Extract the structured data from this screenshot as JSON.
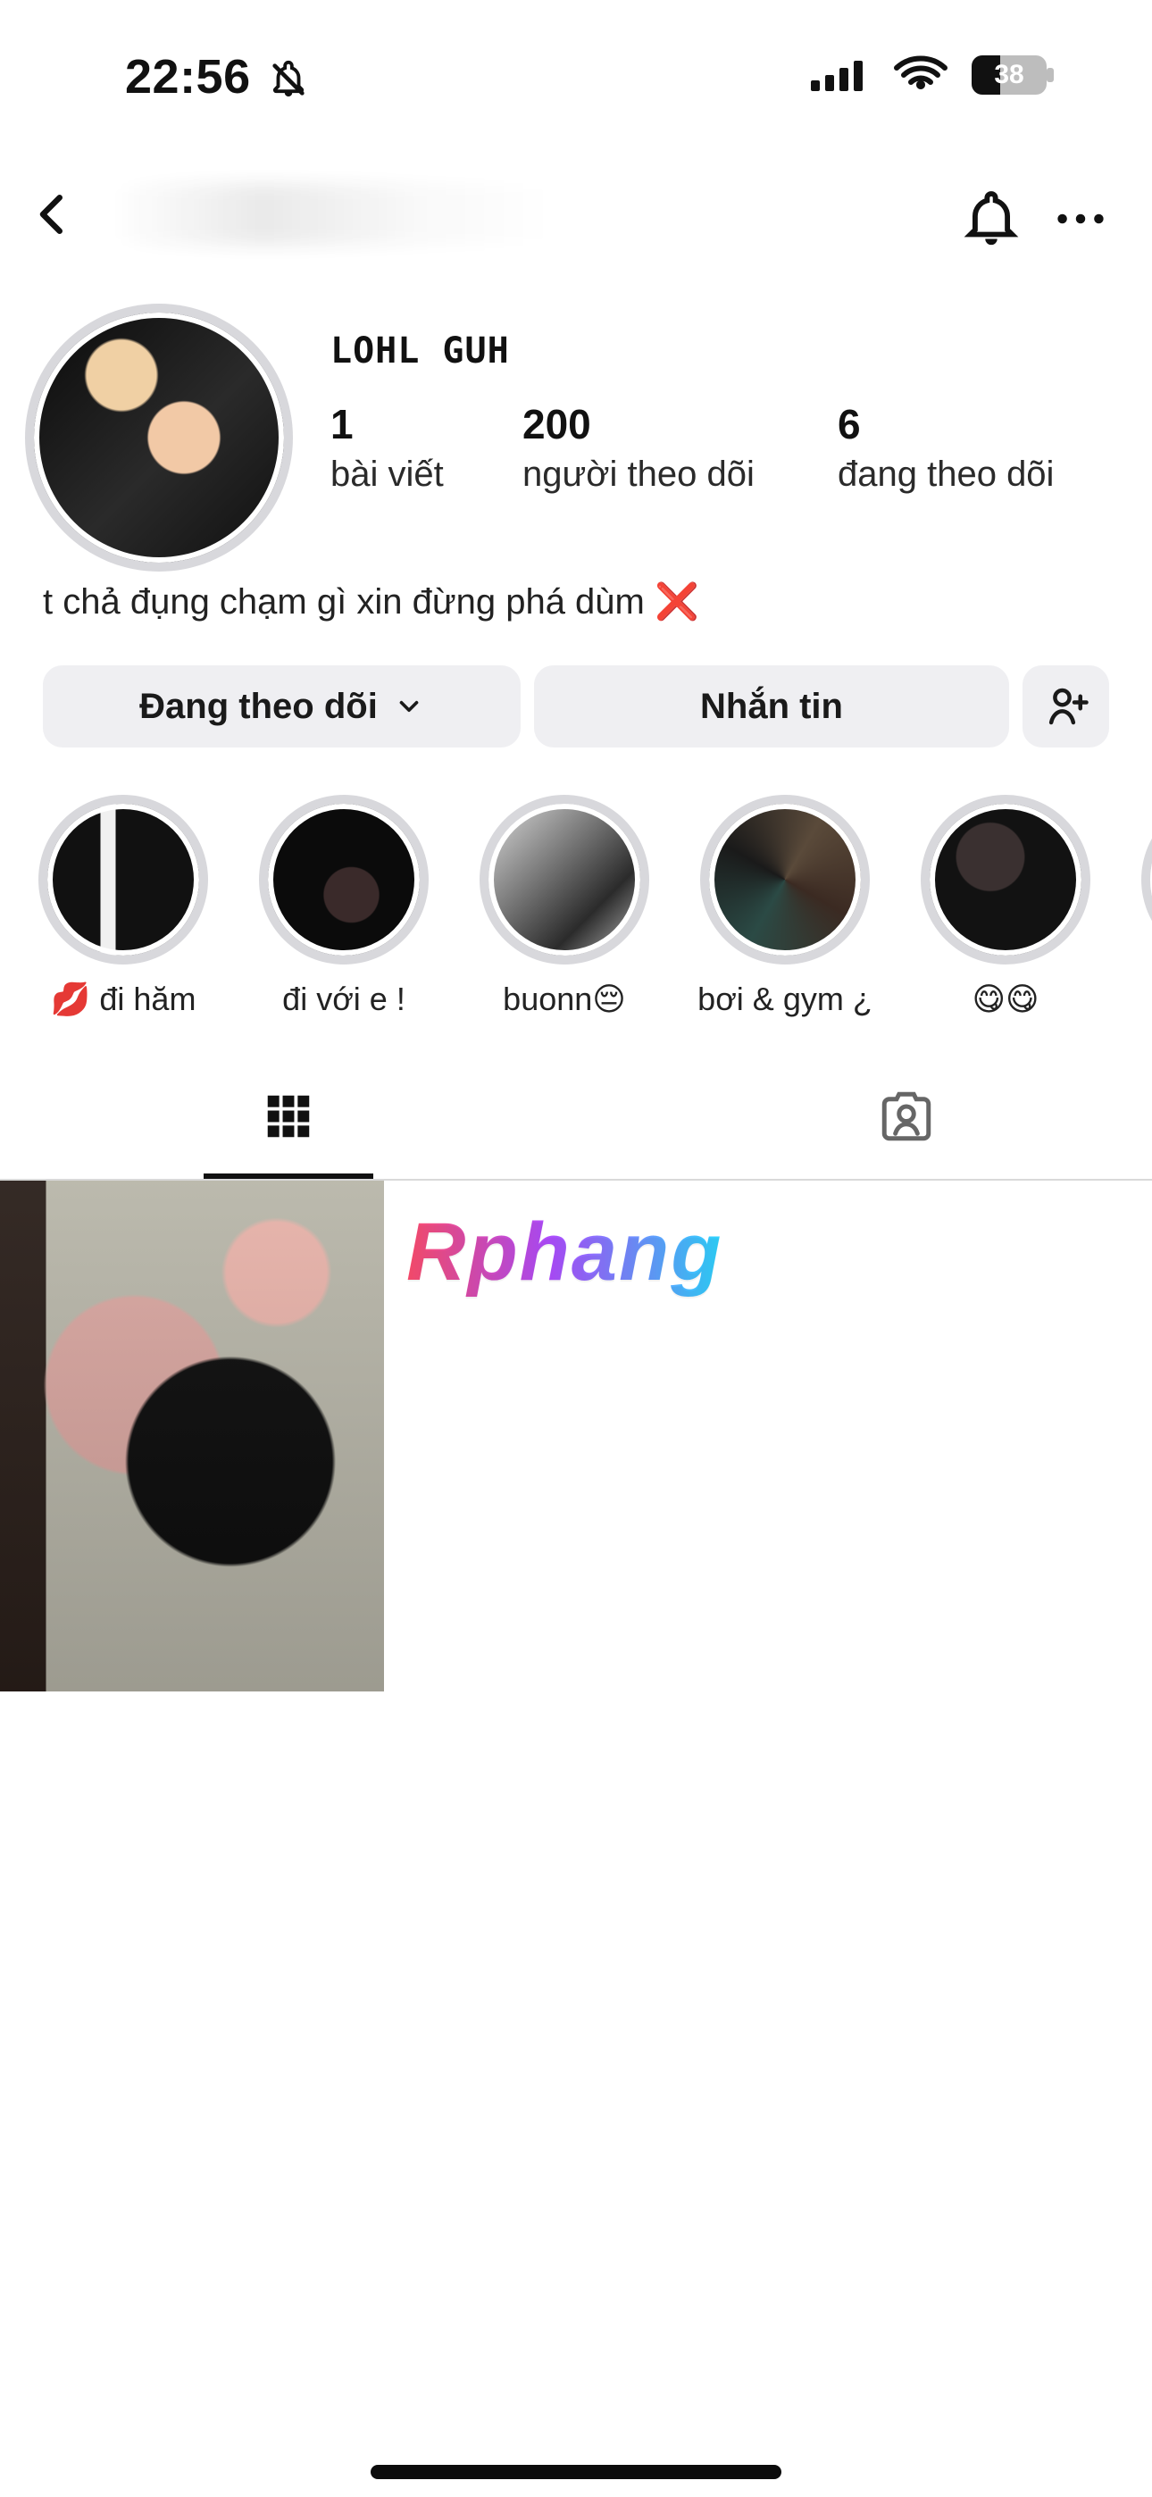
{
  "status_bar": {
    "time": "22:56",
    "battery_percent": "38"
  },
  "profile": {
    "display_name": "LOHL   GUH",
    "stats": [
      {
        "value": "1",
        "label": "bài viết"
      },
      {
        "value": "200",
        "label": "người theo dõi"
      },
      {
        "value": "6",
        "label": "đang theo dõi"
      }
    ],
    "bio": "t chả đụng chạm gì xin đừng phá dùm ❌"
  },
  "actions": {
    "following_label": "Đang theo dõi",
    "message_label": "Nhắn tin"
  },
  "highlights": [
    {
      "label": "💋 đi hăm"
    },
    {
      "label": "đi với e !"
    },
    {
      "label": "buonn😔"
    },
    {
      "label": "bơi & gym ¿"
    },
    {
      "label": "😋😋"
    }
  ],
  "watermark": {
    "text": "Rphang"
  },
  "colors": {
    "button_bg": "#efeff2",
    "ring": "#d8d8dc"
  }
}
